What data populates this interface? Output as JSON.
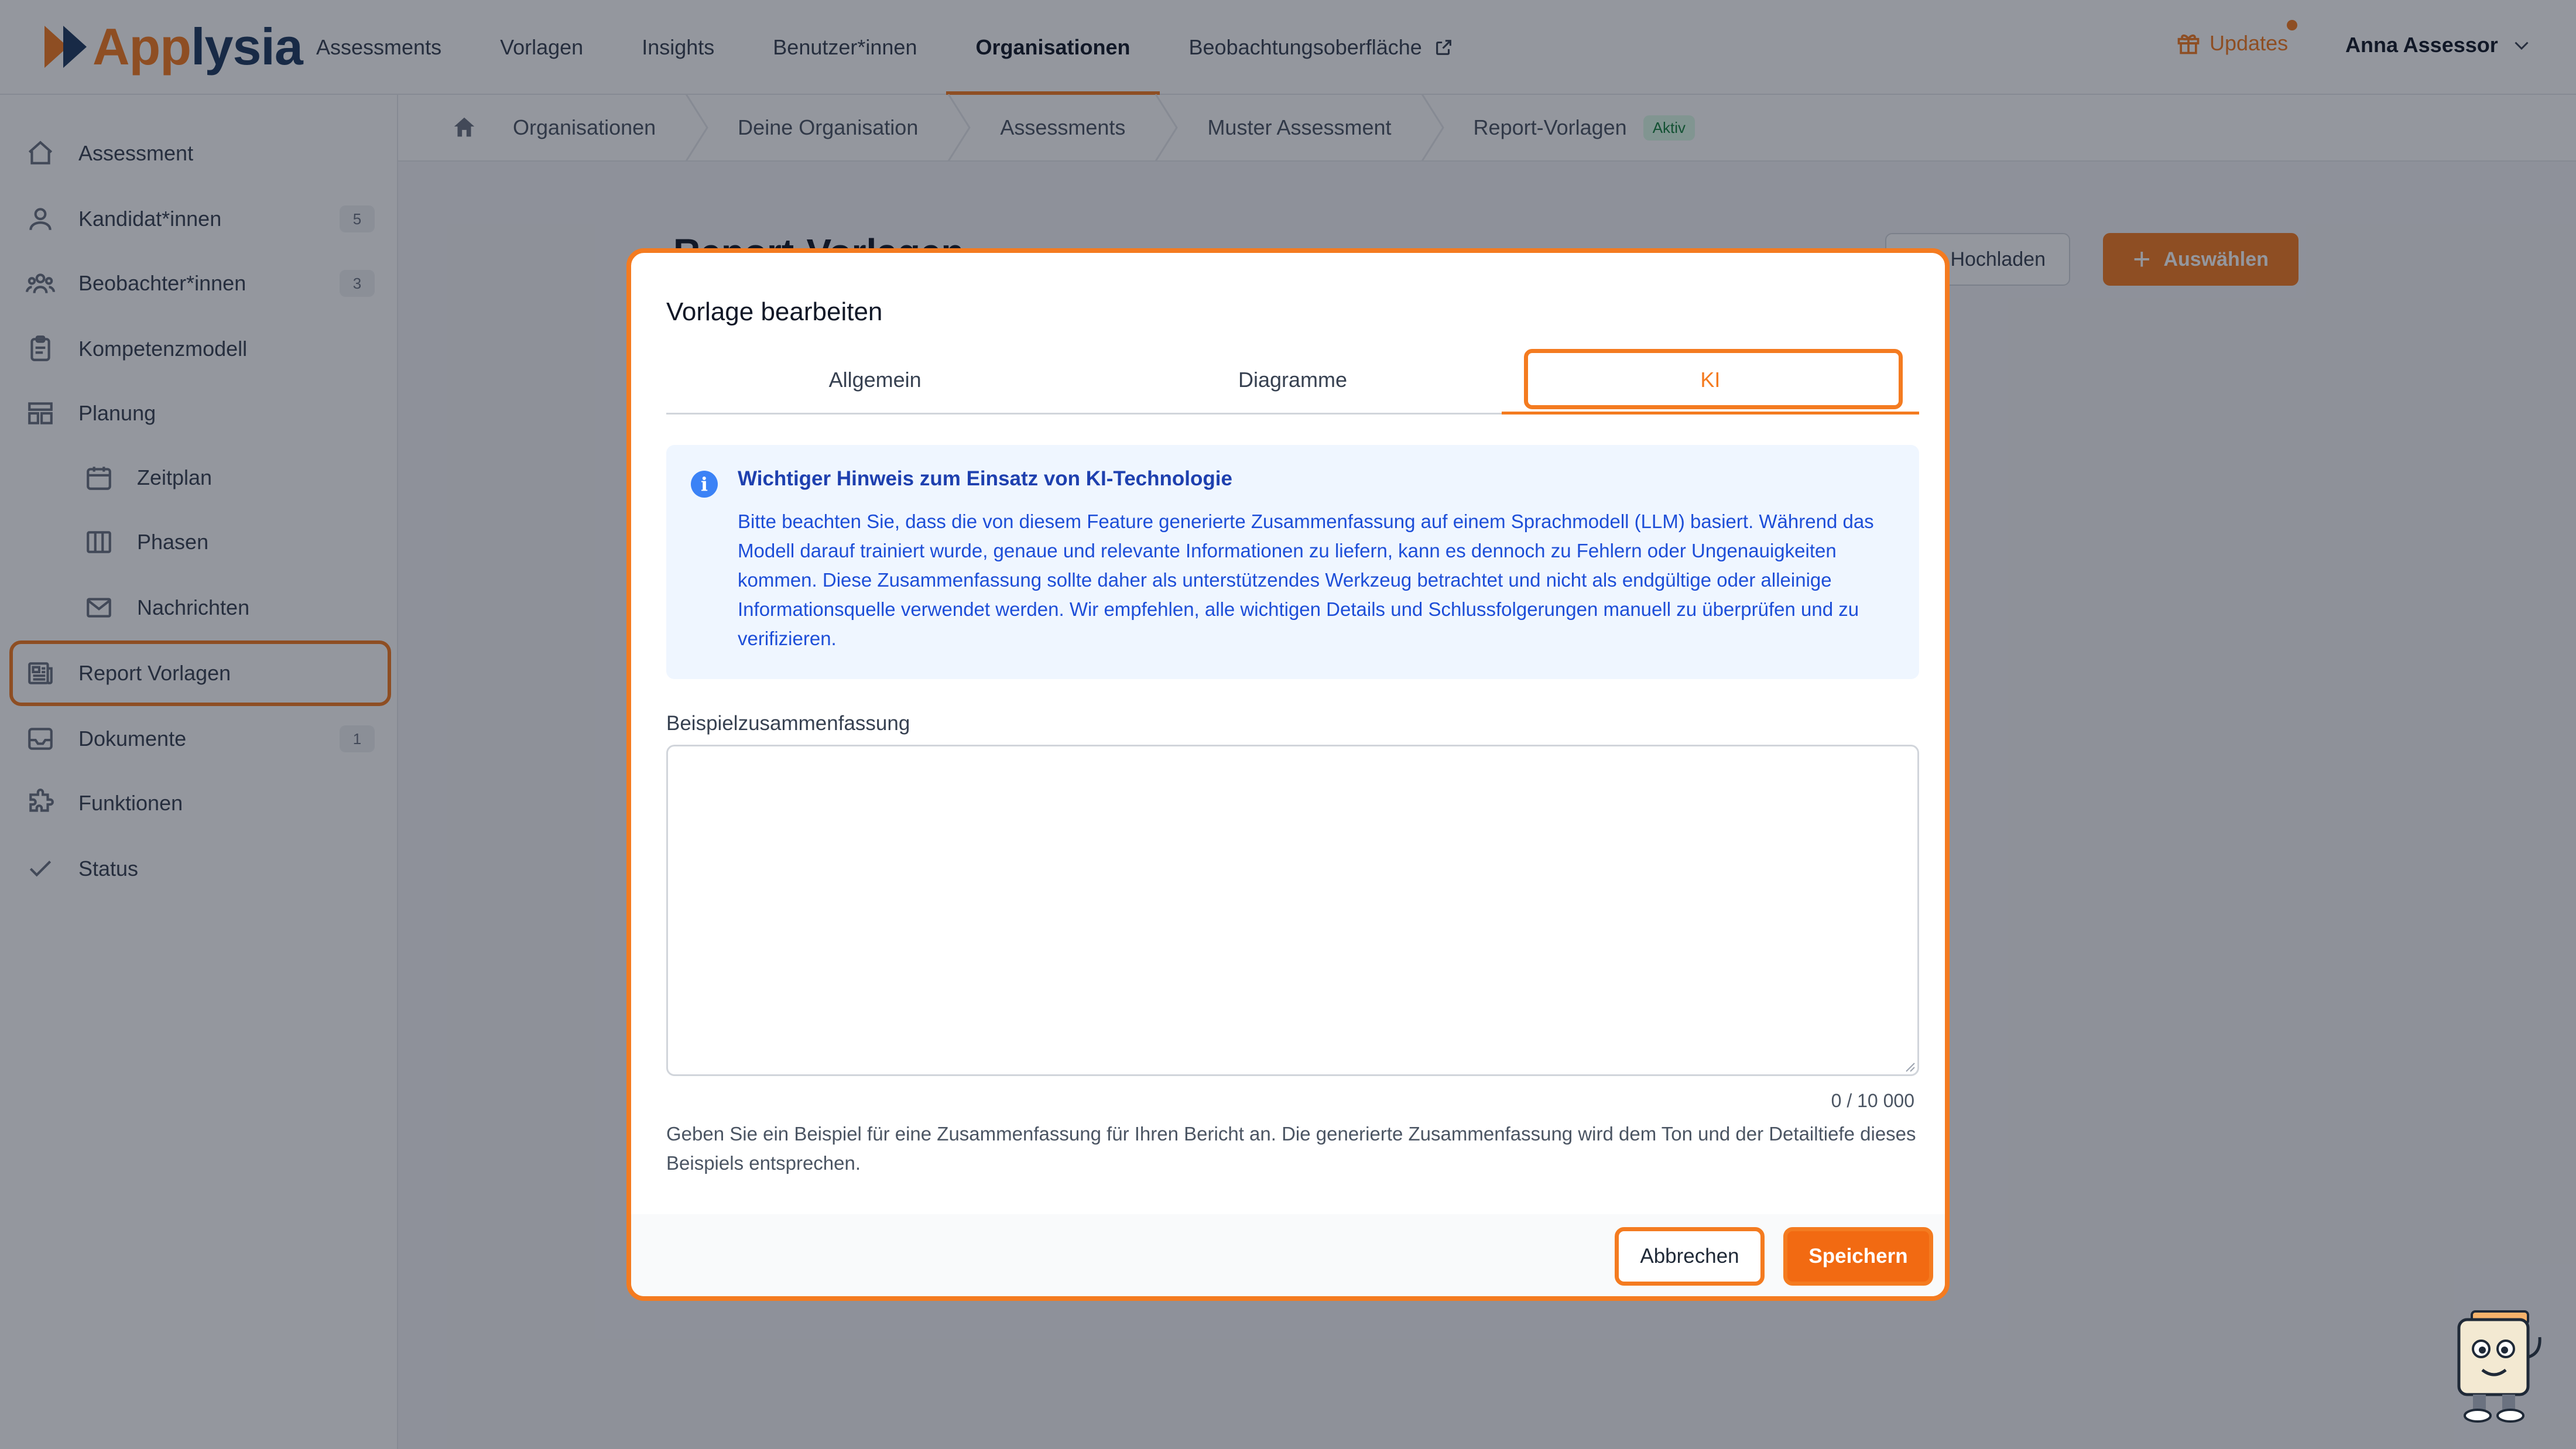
{
  "brand": {
    "logo_part1": "App",
    "logo_part2": "lysia",
    "color_orange": "#f47b20",
    "color_navy": "#1e3a5f"
  },
  "nav": {
    "items": [
      {
        "label": "Assessments"
      },
      {
        "label": "Vorlagen"
      },
      {
        "label": "Insights"
      },
      {
        "label": "Benutzer*innen"
      },
      {
        "label": "Organisationen",
        "active": true
      },
      {
        "label": "Beobachtungsoberfläche",
        "external": true
      }
    ],
    "updates_label": "Updates",
    "user_name": "Anna Assessor"
  },
  "sidebar": {
    "items": [
      {
        "label": "Assessment",
        "icon": "home-icon"
      },
      {
        "label": "Kandidat*innen",
        "icon": "users-icon",
        "count": "5"
      },
      {
        "label": "Beobachter*innen",
        "icon": "group-icon",
        "count": "3"
      },
      {
        "label": "Kompetenzmodell",
        "icon": "clipboard-icon"
      },
      {
        "label": "Planung",
        "icon": "layout-icon"
      },
      {
        "label": "Zeitplan",
        "icon": "calendar-icon",
        "sub": true
      },
      {
        "label": "Phasen",
        "icon": "columns-icon",
        "sub": true
      },
      {
        "label": "Nachrichten",
        "icon": "mail-icon",
        "sub": true
      },
      {
        "label": "Report Vorlagen",
        "icon": "newspaper-icon",
        "active": true
      },
      {
        "label": "Dokumente",
        "icon": "inbox-icon",
        "count": "1"
      },
      {
        "label": "Funktionen",
        "icon": "puzzle-icon"
      },
      {
        "label": "Status",
        "icon": "check-icon"
      }
    ]
  },
  "breadcrumb": {
    "items": [
      "Organisationen",
      "Deine Organisation",
      "Assessments",
      "Muster Assessment",
      "Report-Vorlagen"
    ],
    "status_badge": "Aktiv"
  },
  "page": {
    "title": "Report-Vorlagen",
    "upload_label": "Hochladen",
    "select_label": "Auswählen"
  },
  "modal": {
    "title": "Vorlage bearbeiten",
    "tabs": [
      "Allgemein",
      "Diagramme",
      "KI"
    ],
    "active_tab": "KI",
    "notice_title": "Wichtiger Hinweis zum Einsatz von KI-Technologie",
    "notice_body": "Bitte beachten Sie, dass die von diesem Feature generierte Zusammenfassung auf einem Sprachmodell (LLM) basiert. Während das Modell darauf trainiert wurde, genaue und relevante Informationen zu liefern, kann es dennoch zu Fehlern oder Ungenauigkeiten kommen. Diese Zusammenfassung sollte daher als unterstützendes Werkzeug betrachtet und nicht als endgültige oder alleinige Informationsquelle verwendet werden. Wir empfehlen, alle wichtigen Details und Schlussfolgerungen manuell zu überprüfen und zu verifizieren.",
    "field_label": "Beispielzusammenfassung",
    "field_value": "",
    "counter": "0 / 10 000",
    "hint": "Geben Sie ein Beispiel für eine Zusammenfassung für Ihren Bericht an. Die generierte Zusammenfassung wird dem Ton und der Detailtiefe dieses Beispiels entsprechen.",
    "cancel_label": "Abbrechen",
    "save_label": "Speichern"
  }
}
